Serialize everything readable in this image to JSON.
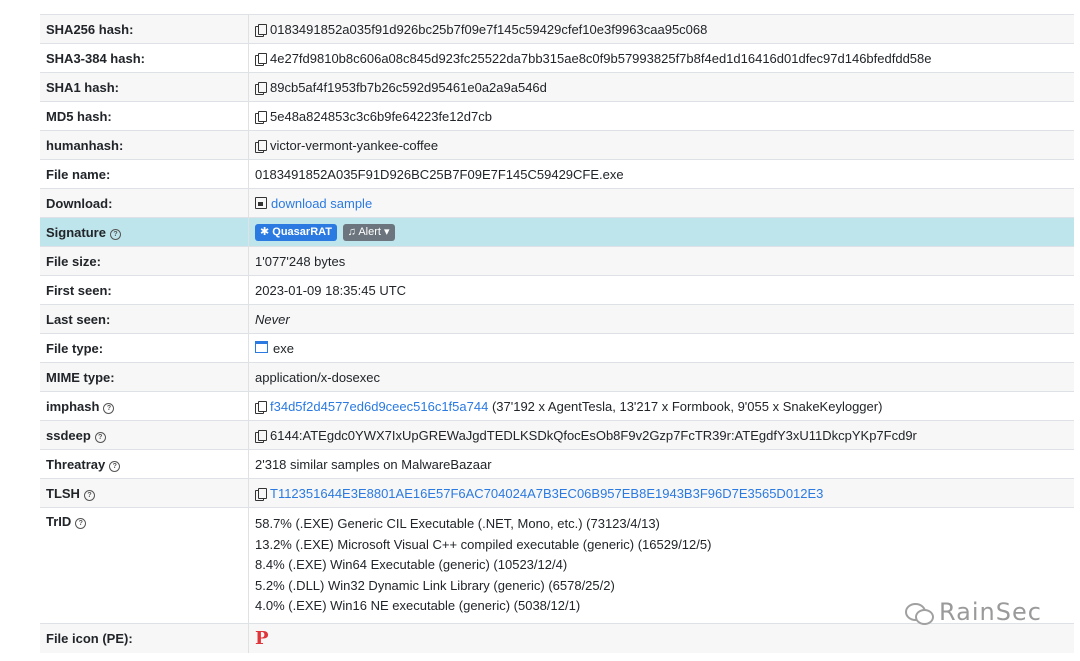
{
  "rows": {
    "sha256": {
      "label": "SHA256 hash:",
      "value": "0183491852a035f91d926bc25b7f09e7f145c59429cfef10e3f9963caa95c068"
    },
    "sha3": {
      "label": "SHA3-384 hash:",
      "value": "4e27fd9810b8c606a08c845d923fc25522da7bb315ae8c0f9b57993825f7b8f4ed1d16416d01dfec97d146bfedfdd58e"
    },
    "sha1": {
      "label": "SHA1 hash:",
      "value": "89cb5af4f1953fb7b26c592d95461e0a2a9a546d"
    },
    "md5": {
      "label": "MD5 hash:",
      "value": "5e48a824853c3c6b9fe64223fe12d7cb"
    },
    "humanhash": {
      "label": "humanhash:",
      "value": "victor-vermont-yankee-coffee"
    },
    "filename": {
      "label": "File name:",
      "value": "0183491852A035F91D926BC25B7F09E7F145C59429CFE.exe"
    },
    "download": {
      "label": "Download:",
      "value": "download sample"
    },
    "signature": {
      "label": "Signature",
      "badge": "QuasarRAT",
      "alert": "Alert"
    },
    "filesize": {
      "label": "File size:",
      "value": "1'077'248 bytes"
    },
    "firstseen": {
      "label": "First seen:",
      "value": "2023-01-09 18:35:45 UTC"
    },
    "lastseen": {
      "label": "Last seen:",
      "value": "Never"
    },
    "filetype": {
      "label": "File type:",
      "value": "exe"
    },
    "mimetype": {
      "label": "MIME type:",
      "value": "application/x-dosexec"
    },
    "imphash": {
      "label": "imphash",
      "link": "f34d5f2d4577ed6d9ceec516c1f5a744",
      "value": "(37'192 x AgentTesla, 13'217 x Formbook, 9'055 x SnakeKeylogger)"
    },
    "ssdeep": {
      "label": "ssdeep",
      "value": "6144:ATEgdc0YWX7IxUpGREWaJgdTEDLKSDkQfocEsOb8F9v2Gzp7FcTR39r:ATEgdfY3xU11DkcpYKp7Fcd9r"
    },
    "threatray": {
      "label": "Threatray",
      "value": "2'318 similar samples on MalwareBazaar"
    },
    "tlsh": {
      "label": "TLSH",
      "value": "T112351644E3E8801AE16E57F6AC704024A7B3EC06B957EB8E1943B3F96D7E3565D012E3"
    },
    "trid": {
      "label": "TrID",
      "lines": [
        "58.7% (.EXE) Generic CIL Executable (.NET, Mono, etc.) (73123/4/13)",
        "13.2% (.EXE) Microsoft Visual C++ compiled executable (generic) (16529/12/5)",
        "8.4% (.EXE) Win64 Executable (generic) (10523/12/4)",
        "5.2% (.DLL) Win32 Dynamic Link Library (generic) (6578/25/2)",
        "4.0% (.EXE) Win16 NE executable (generic) (5038/12/1)"
      ]
    },
    "fileicon": {
      "label": "File icon (PE):",
      "glyph": "P"
    }
  },
  "watermark": "RainSec",
  "colors": {
    "link": "#2a7ae2",
    "highlight_row": "#bee5eb",
    "pe_icon": "#e0353a"
  }
}
